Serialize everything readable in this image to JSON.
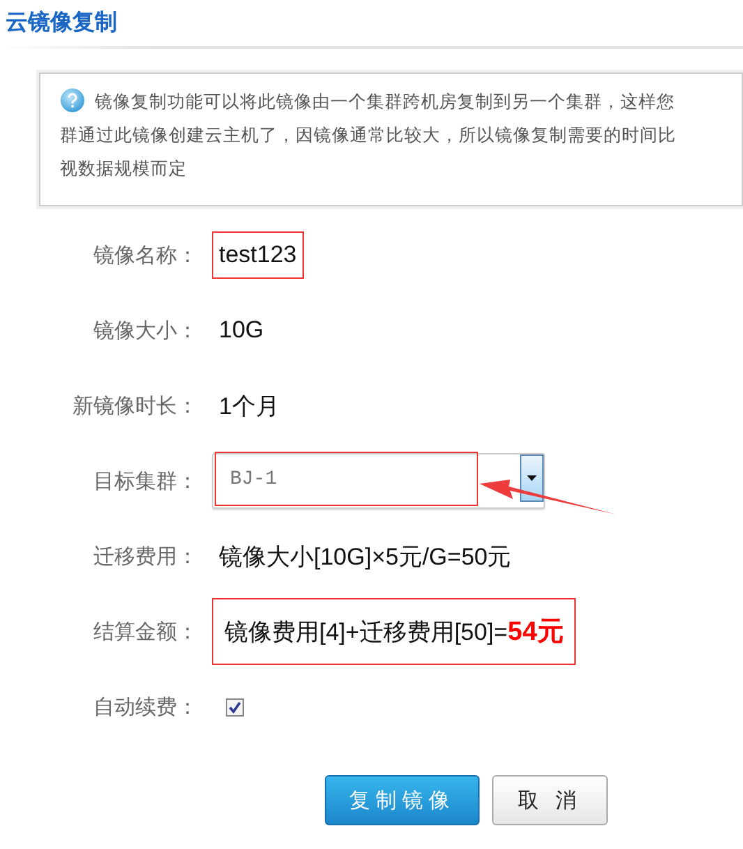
{
  "title": "云镜像复制",
  "info": {
    "lines": [
      "镜像复制功能可以将此镜像由一个集群跨机房复制到另一个集群，这样您",
      "群通过此镜像创建云主机了，因镜像通常比较大，所以镜像复制需要的时间比",
      "视数据规模而定"
    ]
  },
  "fields": [
    {
      "kind": "text",
      "label": "镜像名称：",
      "value": "test123",
      "highlighted": true
    },
    {
      "kind": "text",
      "label": "镜像大小：",
      "value": "10G",
      "highlighted": false
    },
    {
      "kind": "text",
      "label": "新镜像时长：",
      "value": "1个月",
      "highlighted": false
    },
    {
      "kind": "select",
      "label": "目标集群：",
      "value": "BJ-1",
      "highlighted": true
    },
    {
      "kind": "text",
      "label": "迁移费用：",
      "value": "镜像大小[10G]×5元/G=50元",
      "highlighted": false
    },
    {
      "kind": "total",
      "label": "结算金额：",
      "value": "镜像费用[4]+迁移费用[50]=**54元**",
      "highlighted": true
    },
    {
      "kind": "checkbox",
      "label": "自动续费：",
      "checked": true,
      "highlighted": false
    }
  ],
  "buttons": [
    {
      "label": "复制镜像",
      "primary": true
    },
    {
      "label": "取 消",
      "primary": false
    }
  ]
}
